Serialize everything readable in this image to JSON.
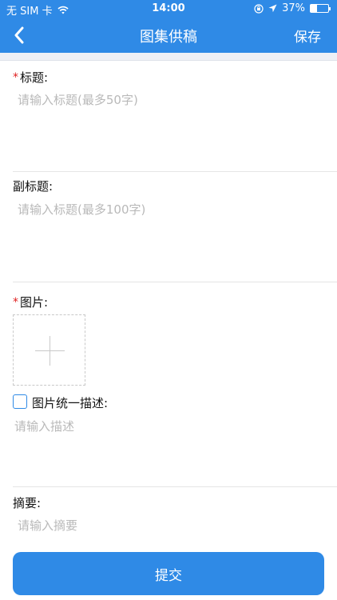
{
  "status_bar": {
    "carrier": "无 SIM 卡",
    "time": "14:00",
    "battery_text": "37%",
    "battery_level": 0.37
  },
  "nav": {
    "title": "图集供稿",
    "save_label": "保存"
  },
  "form": {
    "title": {
      "required_mark": "*",
      "label": "标题:",
      "placeholder": "请输入标题(最多50字)"
    },
    "subtitle": {
      "label": "副标题:",
      "placeholder": "请输入标题(最多100字)"
    },
    "images": {
      "required_mark": "*",
      "label": "图片:"
    },
    "unified_description": {
      "label": "图片统一描述:",
      "checked": false,
      "placeholder": "请输入描述"
    },
    "summary": {
      "label": "摘要:",
      "placeholder": "请输入摘要"
    }
  },
  "submit_label": "提交",
  "colors": {
    "primary": "#2f8ae6",
    "required": "#e02020",
    "placeholder": "#b9b9b9"
  }
}
